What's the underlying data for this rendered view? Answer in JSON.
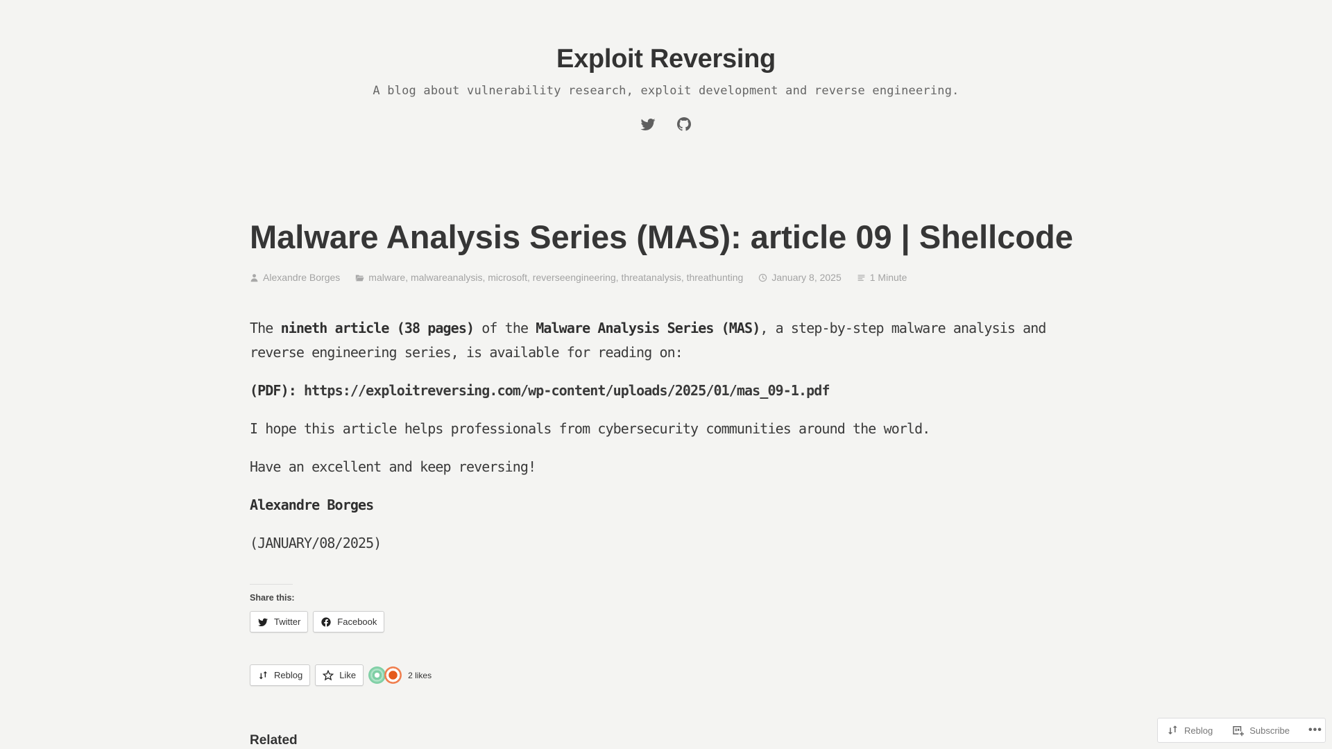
{
  "site": {
    "title": "Exploit Reversing",
    "description": "A blog about vulnerability research, exploit development and reverse engineering.",
    "social": [
      {
        "name": "twitter",
        "icon": "twitter-icon"
      },
      {
        "name": "github",
        "icon": "github-icon"
      }
    ]
  },
  "post": {
    "title": "Malware Analysis Series (MAS): article 09 | Shellcode",
    "meta": {
      "author": "Alexandre Borges",
      "categories": [
        "malware",
        "malwareanalysis",
        "microsoft",
        "reverseengineering",
        "threatanalysis",
        "threathunting"
      ],
      "categories_text": "malware, malwareanalysis, microsoft, reverseengineering, threatanalysis, threathunting",
      "date": "January 8, 2025",
      "reading_time": "1 Minute"
    },
    "content": {
      "p1": {
        "t1": "The ",
        "b1": "nineth article (38 pages)",
        "t2": " of the ",
        "b2": "Malware Analysis Series (MAS)",
        "t3": ", a step-by-step malware analysis and reverse engineering series, is available for reading on:"
      },
      "pdf_label": "(PDF): ",
      "pdf_link": "https://exploitreversing.com/wp-content/uploads/2025/01/mas_09-1.pdf",
      "p3": "I hope this article helps professionals from cybersecurity communities around the world.",
      "p4": "Have an excellent and keep reversing!",
      "signature": "Alexandre Borges",
      "sign_date": "(JANUARY/08/2025)"
    }
  },
  "share": {
    "title": "Share this:",
    "buttons": [
      {
        "label": "Twitter",
        "icon": "twitter-icon"
      },
      {
        "label": "Facebook",
        "icon": "facebook-icon"
      }
    ]
  },
  "likes": {
    "reblog_label": "Reblog",
    "like_label": "Like",
    "count_text": "2 likes"
  },
  "related": {
    "title": "Related"
  },
  "actionbar": {
    "reblog": "Reblog",
    "subscribe": "Subscribe",
    "more": "•••"
  }
}
